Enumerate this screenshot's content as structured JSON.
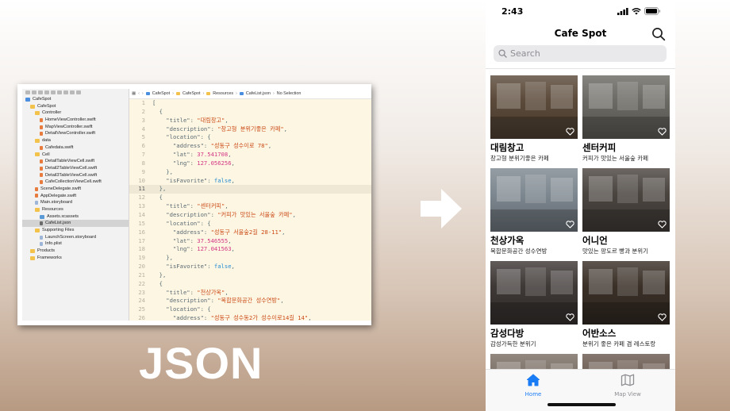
{
  "xcode": {
    "navigator": [
      {
        "label": "CafeSpot",
        "indent": 0,
        "icon": "proj"
      },
      {
        "label": "CafeSpot",
        "indent": 1,
        "icon": "folder"
      },
      {
        "label": "Controller",
        "indent": 2,
        "icon": "folder"
      },
      {
        "label": "HomeViewController.swift",
        "indent": 3,
        "icon": "swift"
      },
      {
        "label": "MapViewController.swift",
        "indent": 3,
        "icon": "swift"
      },
      {
        "label": "DetailViewController.swift",
        "indent": 3,
        "icon": "swift"
      },
      {
        "label": "data",
        "indent": 2,
        "icon": "folder"
      },
      {
        "label": "Cafedata.swift",
        "indent": 3,
        "icon": "swift"
      },
      {
        "label": "Cell",
        "indent": 2,
        "icon": "folder"
      },
      {
        "label": "DetailTableViewCell.swift",
        "indent": 3,
        "icon": "swift"
      },
      {
        "label": "Detail2TableViewCell.swift",
        "indent": 3,
        "icon": "swift"
      },
      {
        "label": "Detail3TableViewCell.swift",
        "indent": 3,
        "icon": "swift"
      },
      {
        "label": "CafeCollectionViewCell.swift",
        "indent": 3,
        "icon": "swift"
      },
      {
        "label": "SceneDelegate.swift",
        "indent": 2,
        "icon": "swift"
      },
      {
        "label": "AppDelegate.swift",
        "indent": 2,
        "icon": "swift"
      },
      {
        "label": "Main.storyboard",
        "indent": 2,
        "icon": "file"
      },
      {
        "label": "Resources",
        "indent": 2,
        "icon": "folder"
      },
      {
        "label": "Assets.xcassets",
        "indent": 3,
        "icon": "asset"
      },
      {
        "label": "CafeList.json",
        "indent": 3,
        "icon": "json",
        "selected": true
      },
      {
        "label": "Supporting Files",
        "indent": 2,
        "icon": "folder"
      },
      {
        "label": "LaunchScreen.storyboard",
        "indent": 3,
        "icon": "file"
      },
      {
        "label": "Info.plist",
        "indent": 3,
        "icon": "file"
      },
      {
        "label": "Products",
        "indent": 1,
        "icon": "folder"
      },
      {
        "label": "Frameworks",
        "indent": 1,
        "icon": "folder"
      }
    ],
    "breadcrumb": [
      "CafeSpot",
      "CafeSpot",
      "Resources",
      "CafeList.json",
      "No Selection"
    ],
    "current_line": 11,
    "code_lines": [
      [
        [
          "[",
          "p"
        ]
      ],
      [
        [
          "  {",
          "p"
        ]
      ],
      [
        [
          "    \"title\"",
          "k"
        ],
        [
          ": ",
          "p"
        ],
        [
          "\"대림창고\"",
          "s"
        ],
        [
          ",",
          "p"
        ]
      ],
      [
        [
          "    \"description\"",
          "k"
        ],
        [
          ": ",
          "p"
        ],
        [
          "\"창고형 분위기좋은 카페\"",
          "s"
        ],
        [
          ",",
          "p"
        ]
      ],
      [
        [
          "    \"location\"",
          "k"
        ],
        [
          ": {",
          "p"
        ]
      ],
      [
        [
          "      \"address\"",
          "k"
        ],
        [
          ": ",
          "p"
        ],
        [
          "\"성동구 성수이로 78\"",
          "s"
        ],
        [
          ",",
          "p"
        ]
      ],
      [
        [
          "      \"lat\"",
          "k"
        ],
        [
          ": ",
          "p"
        ],
        [
          "37.541708",
          "n"
        ],
        [
          ",",
          "p"
        ]
      ],
      [
        [
          "      \"lng\"",
          "k"
        ],
        [
          ": ",
          "p"
        ],
        [
          "127.056256",
          "n"
        ],
        [
          ",",
          "p"
        ]
      ],
      [
        [
          "    },",
          "p"
        ]
      ],
      [
        [
          "    \"isFavorite\"",
          "k"
        ],
        [
          ": ",
          "p"
        ],
        [
          "false",
          "b"
        ],
        [
          ",",
          "p"
        ]
      ],
      [
        [
          "  },",
          "p"
        ]
      ],
      [
        [
          "  {",
          "p"
        ]
      ],
      [
        [
          "    \"title\"",
          "k"
        ],
        [
          ": ",
          "p"
        ],
        [
          "\"센터커피\"",
          "s"
        ],
        [
          ",",
          "p"
        ]
      ],
      [
        [
          "    \"description\"",
          "k"
        ],
        [
          ": ",
          "p"
        ],
        [
          "\"커피가 맛있는 서울숲 카페\"",
          "s"
        ],
        [
          ",",
          "p"
        ]
      ],
      [
        [
          "    \"location\"",
          "k"
        ],
        [
          ": {",
          "p"
        ]
      ],
      [
        [
          "      \"address\"",
          "k"
        ],
        [
          ": ",
          "p"
        ],
        [
          "\"성동구 서울숲2길 28-11\"",
          "s"
        ],
        [
          ",",
          "p"
        ]
      ],
      [
        [
          "      \"lat\"",
          "k"
        ],
        [
          ": ",
          "p"
        ],
        [
          "37.546555",
          "n"
        ],
        [
          ",",
          "p"
        ]
      ],
      [
        [
          "      \"lng\"",
          "k"
        ],
        [
          ": ",
          "p"
        ],
        [
          "127.041563",
          "n"
        ],
        [
          ",",
          "p"
        ]
      ],
      [
        [
          "    },",
          "p"
        ]
      ],
      [
        [
          "    \"isFavorite\"",
          "k"
        ],
        [
          ": ",
          "p"
        ],
        [
          "false",
          "b"
        ],
        [
          ",",
          "p"
        ]
      ],
      [
        [
          "  },",
          "p"
        ]
      ],
      [
        [
          "  {",
          "p"
        ]
      ],
      [
        [
          "    \"title\"",
          "k"
        ],
        [
          ": ",
          "p"
        ],
        [
          "\"천상가옥\"",
          "s"
        ],
        [
          ",",
          "p"
        ]
      ],
      [
        [
          "    \"description\"",
          "k"
        ],
        [
          ": ",
          "p"
        ],
        [
          "\"복합문화공간 성수연방\"",
          "s"
        ],
        [
          ",",
          "p"
        ]
      ],
      [
        [
          "    \"location\"",
          "k"
        ],
        [
          ": {",
          "p"
        ]
      ],
      [
        [
          "      \"address\"",
          "k"
        ],
        [
          ": ",
          "p"
        ],
        [
          "\"성동구 성수동2가 성수이로14길 14\"",
          "s"
        ],
        [
          ",",
          "p"
        ]
      ]
    ]
  },
  "caption": "JSON",
  "phone": {
    "status_time": "2:43",
    "nav_title": "Cafe Spot",
    "search_placeholder": "Search",
    "cafes": [
      {
        "title": "대림창고",
        "desc": "창고형 분위기좋은 카페",
        "tone": "#5b4a3a"
      },
      {
        "title": "센터커피",
        "desc": "커피가 맛있는 서울숲 카페",
        "tone": "#6c6a64"
      },
      {
        "title": "천상가옥",
        "desc": "복합문화공간 성수연방",
        "tone": "#7e8890"
      },
      {
        "title": "어니언",
        "desc": "맛있는 팡도르 빵과 분위기",
        "tone": "#4b4540"
      },
      {
        "title": "감성다방",
        "desc": "감성가득한 분위기",
        "tone": "#3e3836"
      },
      {
        "title": "어반소스",
        "desc": "분위기 좋은 카페 겸 레스토랑",
        "tone": "#3a3028"
      },
      {
        "title": "",
        "desc": "",
        "tone": "#7a6e64"
      },
      {
        "title": "",
        "desc": "",
        "tone": "#6a5a50"
      }
    ],
    "tabs": [
      {
        "label": "Home",
        "icon": "house-icon",
        "active": true
      },
      {
        "label": "Map View",
        "icon": "map-icon",
        "active": false
      }
    ],
    "accent": "#1a7cf5"
  }
}
